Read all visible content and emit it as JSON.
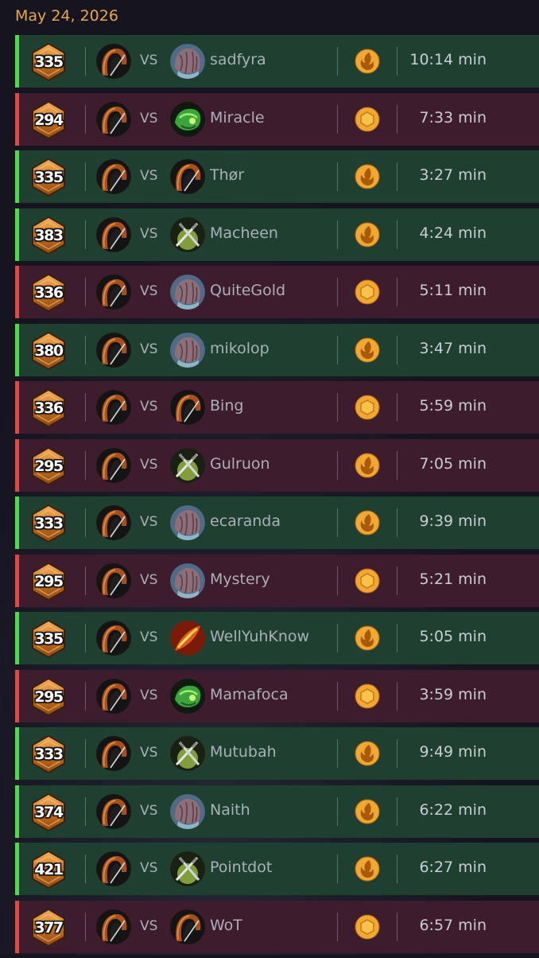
{
  "date": "May 24, 2026",
  "vs_label": "VS",
  "colors": {
    "win_bg": "#1f3f30",
    "win_accent": "#4cdb4c",
    "loss_bg": "#3d1c2e",
    "loss_accent": "#e04848",
    "date_text": "#e8a84a",
    "badge": "#c9731f",
    "mode_icon": "#f0a830"
  },
  "matches": [
    {
      "result": "win",
      "rating": "335",
      "opponent": "sadfyra",
      "opponent_avatar": "stone-gargoyle-icon",
      "mode": "flame-mode-icon",
      "duration": "10:14 min"
    },
    {
      "result": "loss",
      "rating": "294",
      "opponent": "Miracle",
      "opponent_avatar": "green-beast-icon",
      "mode": "coin-mode-icon",
      "duration": "7:33 min"
    },
    {
      "result": "win",
      "rating": "335",
      "opponent": "Thør",
      "opponent_avatar": "hooded-hero-icon",
      "mode": "flame-mode-icon",
      "duration": "3:27 min"
    },
    {
      "result": "win",
      "rating": "383",
      "opponent": "Macheen",
      "opponent_avatar": "crossed-swords-icon",
      "mode": "flame-mode-icon",
      "duration": "4:24 min"
    },
    {
      "result": "loss",
      "rating": "336",
      "opponent": "QuiteGold",
      "opponent_avatar": "stone-gargoyle-icon",
      "mode": "coin-mode-icon",
      "duration": "5:11 min"
    },
    {
      "result": "win",
      "rating": "380",
      "opponent": "mikolop",
      "opponent_avatar": "stone-gargoyle-icon",
      "mode": "flame-mode-icon",
      "duration": "3:47 min"
    },
    {
      "result": "loss",
      "rating": "336",
      "opponent": "Bing",
      "opponent_avatar": "hooded-hero-icon",
      "mode": "coin-mode-icon",
      "duration": "5:59 min"
    },
    {
      "result": "loss",
      "rating": "295",
      "opponent": "Gulruon",
      "opponent_avatar": "crossed-swords-icon",
      "mode": "flame-mode-icon",
      "duration": "7:05 min"
    },
    {
      "result": "win",
      "rating": "333",
      "opponent": "ecaranda",
      "opponent_avatar": "stone-gargoyle-icon",
      "mode": "flame-mode-icon",
      "duration": "9:39 min"
    },
    {
      "result": "loss",
      "rating": "295",
      "opponent": "Mystery",
      "opponent_avatar": "stone-gargoyle-icon",
      "mode": "coin-mode-icon",
      "duration": "5:21 min"
    },
    {
      "result": "win",
      "rating": "335",
      "opponent": "WellYuhKnow",
      "opponent_avatar": "fire-feather-icon",
      "mode": "flame-mode-icon",
      "duration": "5:05 min"
    },
    {
      "result": "loss",
      "rating": "295",
      "opponent": "Mamafoca",
      "opponent_avatar": "green-beast-icon",
      "mode": "coin-mode-icon",
      "duration": "3:59 min"
    },
    {
      "result": "win",
      "rating": "333",
      "opponent": "Mutubah",
      "opponent_avatar": "crossed-swords-icon",
      "mode": "flame-mode-icon",
      "duration": "9:49 min"
    },
    {
      "result": "win",
      "rating": "374",
      "opponent": "Naith",
      "opponent_avatar": "stone-gargoyle-icon",
      "mode": "flame-mode-icon",
      "duration": "6:22 min"
    },
    {
      "result": "win",
      "rating": "421",
      "opponent": "Pointdot",
      "opponent_avatar": "crossed-swords-icon",
      "mode": "flame-mode-icon",
      "duration": "6:27 min"
    },
    {
      "result": "loss",
      "rating": "377",
      "opponent": "WoT",
      "opponent_avatar": "hooded-hero-icon",
      "mode": "coin-mode-icon",
      "duration": "6:57 min"
    }
  ]
}
